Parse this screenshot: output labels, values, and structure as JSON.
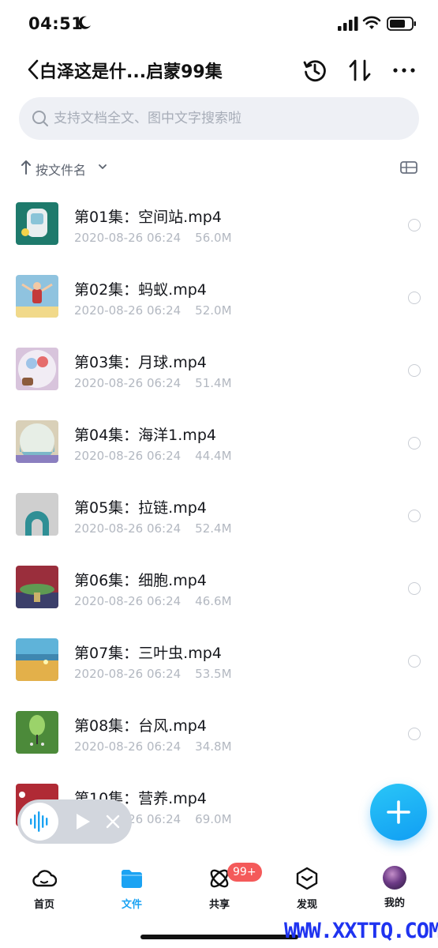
{
  "status_bar": {
    "time": "04:51"
  },
  "header": {
    "title": "白泽这是什...启蒙99集"
  },
  "search": {
    "placeholder": "支持文档全文、图中文字搜索啦"
  },
  "sort": {
    "label": "按文件名"
  },
  "files": [
    {
      "name": "第01集：空间站.mp4",
      "date": "2020-08-26 06:24",
      "size": "56.0M",
      "thumb_color": "#1e7a6c"
    },
    {
      "name": "第02集：蚂蚁.mp4",
      "date": "2020-08-26 06:24",
      "size": "52.0M",
      "thumb_color": "#8fc3df"
    },
    {
      "name": "第03集：月球.mp4",
      "date": "2020-08-26 06:24",
      "size": "51.4M",
      "thumb_color": "#d8c4dc"
    },
    {
      "name": "第04集：海洋1.mp4",
      "date": "2020-08-26 06:24",
      "size": "44.4M",
      "thumb_color": "#d9d0b8"
    },
    {
      "name": "第05集：拉链.mp4",
      "date": "2020-08-26 06:24",
      "size": "52.4M",
      "thumb_color": "#cfcfcf"
    },
    {
      "name": "第06集：细胞.mp4",
      "date": "2020-08-26 06:24",
      "size": "46.6M",
      "thumb_color": "#9a2e3c"
    },
    {
      "name": "第07集：三叶虫.mp4",
      "date": "2020-08-26 06:24",
      "size": "53.5M",
      "thumb_color": "#e3b04a"
    },
    {
      "name": "第08集：台风.mp4",
      "date": "2020-08-26 06:24",
      "size": "34.8M",
      "thumb_color": "#4c8a3a"
    },
    {
      "name": "第10集：营养.mp4",
      "date": "2020-08-26 06:24",
      "size": "69.0M",
      "thumb_color": "#b02a35"
    }
  ],
  "nav": {
    "home": "首页",
    "files": "文件",
    "share": "共享",
    "discover": "发现",
    "mine": "我的",
    "share_badge": "99+"
  },
  "colors": {
    "accent": "#1ba3f3",
    "badge": "#f45a5a"
  },
  "watermark": "WWW.XXTTQ.COM"
}
